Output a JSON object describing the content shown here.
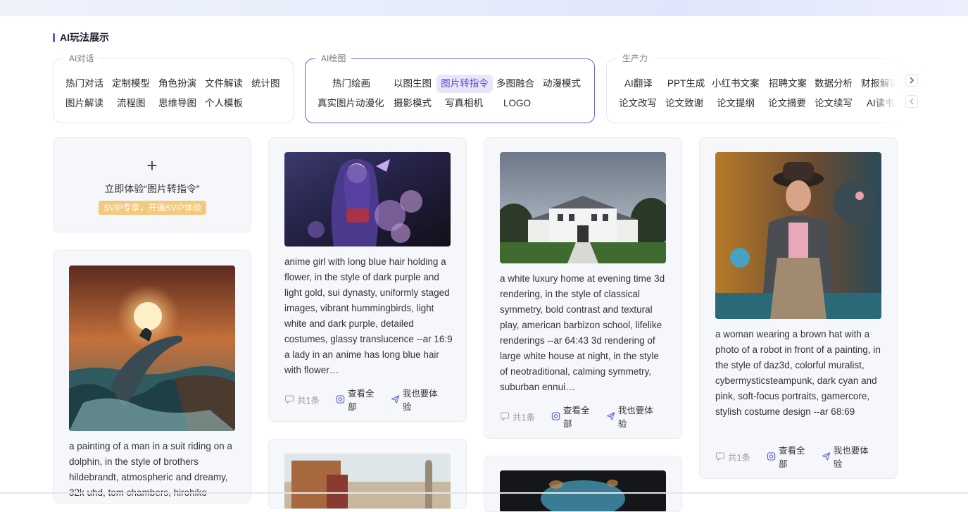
{
  "section_title": "AI玩法展示",
  "groups": [
    {
      "title": "AI对话",
      "chips": [
        "热门对话",
        "定制模型",
        "角色扮演",
        "文件解读",
        "统计图",
        "图片解读",
        "流程图",
        "思维导图",
        "个人模板"
      ]
    },
    {
      "title": "AI绘图",
      "chips": [
        "热门绘画",
        "以图生图",
        "图片转指令",
        "多图融合",
        "动漫模式",
        "真实图片动漫化",
        "摄影模式",
        "写真相机",
        "LOGO"
      ],
      "selected": "图片转指令"
    },
    {
      "title": "生产力",
      "chips": [
        "AI翻译",
        "PPT生成",
        "小红书文案",
        "招聘文案",
        "数据分析",
        "财报解读",
        "论文改写",
        "论文致谢",
        "论文提纲",
        "论文摘要",
        "论文续写",
        "AI读书"
      ]
    }
  ],
  "nav": {
    "next_icon": "chevron-right-icon",
    "prev_icon": "chevron-left-icon"
  },
  "try_card": {
    "text": "立即体验“图片转指令”",
    "badge": "SVIP专享，开通SVIP体验"
  },
  "cards": [
    {
      "id": "dolphin",
      "desc": "a painting of a man in a suit riding on a dolphin, in the style of brothers hildebrandt, atmospheric and dreamy, 32k uhd, tom chambers, hirohiko"
    },
    {
      "id": "anime",
      "desc": "anime girl with long blue hair holding a flower, in the style of dark purple and light gold, sui dynasty, uniformly staged images, vibrant hummingbirds, light white and dark purple, detailed costumes, glassy translucence --ar 16:9 a lady in an anime has long blue hair with flower…",
      "count": "共1条",
      "view_all": "查看全部",
      "try": "我也要体验"
    },
    {
      "id": "house",
      "desc": "a white luxury home at evening time 3d rendering, in the style of classical symmetry, bold contrast and textural play, american barbizon school, lifelike renderings --ar 64:43 3d rendering of large white house at night, in the style of neotraditional, calming symmetry, suburban ennui…",
      "count": "共1条",
      "view_all": "查看全部",
      "try": "我也要体验"
    },
    {
      "id": "woman",
      "desc": "a woman wearing a brown hat with a photo of a robot in front of a painting, in the style of daz3d, colorful muralist, cybermysticsteampunk, dark cyan and pink, soft-focus portraits, gamercore, stylish costume design --ar 68:69",
      "count": "共1条",
      "view_all": "查看全部",
      "try": "我也要体验"
    }
  ],
  "colors": {
    "accent": "#5b5bd6",
    "badge": "#f3c97e",
    "card_bg": "#f6f7fa"
  }
}
